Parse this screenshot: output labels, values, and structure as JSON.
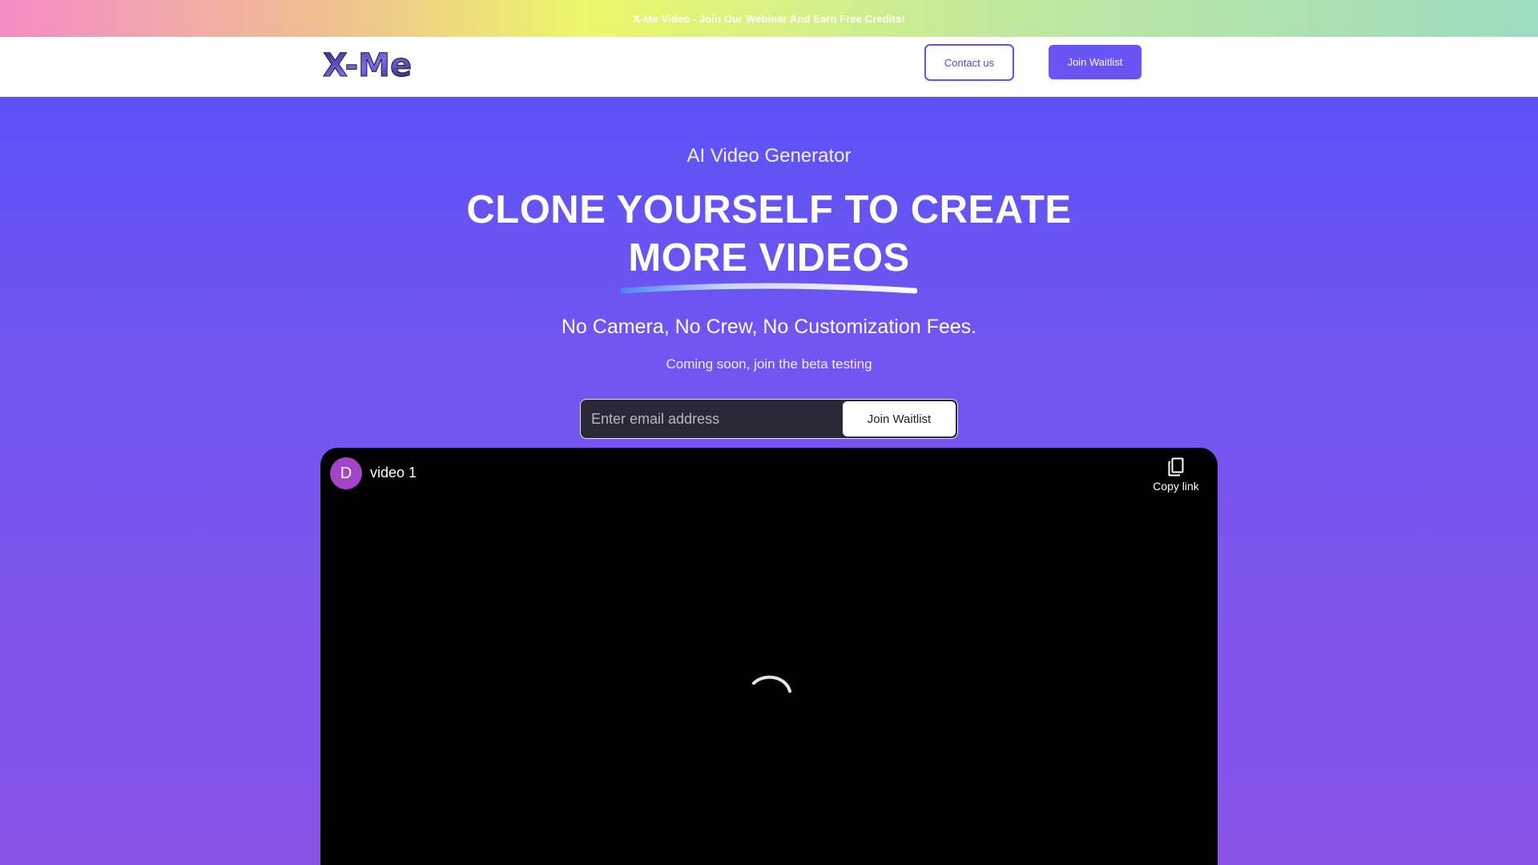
{
  "announcement": {
    "text": "X-Me Video - Join Our Webinar And Earn Free Credits!"
  },
  "nav": {
    "logo_text": "X-Me",
    "contact_label": "Contact us",
    "join_label": "Join Waitlist"
  },
  "hero": {
    "eyebrow": "AI Video Generator",
    "headline_line1": "CLONE YOURSELF TO CREATE",
    "headline_line2": "MORE VIDEOS",
    "tagline": "No Camera, No Crew, No Customization Fees.",
    "subtext": "Coming soon, join the beta testing"
  },
  "signup": {
    "placeholder": "Enter email address",
    "button_label": "Join Waitlist"
  },
  "video": {
    "avatar_initial": "D",
    "title": "video 1",
    "copy_label": "Copy link",
    "state": "loading"
  },
  "colors": {
    "brand_purple": "#6a53f3",
    "hero_top": "#5c52f6",
    "hero_bottom": "#8854e6",
    "avatar": "#a245c9"
  },
  "icons": {
    "copy": "copy-icon",
    "spinner": "loading-spinner-icon"
  }
}
